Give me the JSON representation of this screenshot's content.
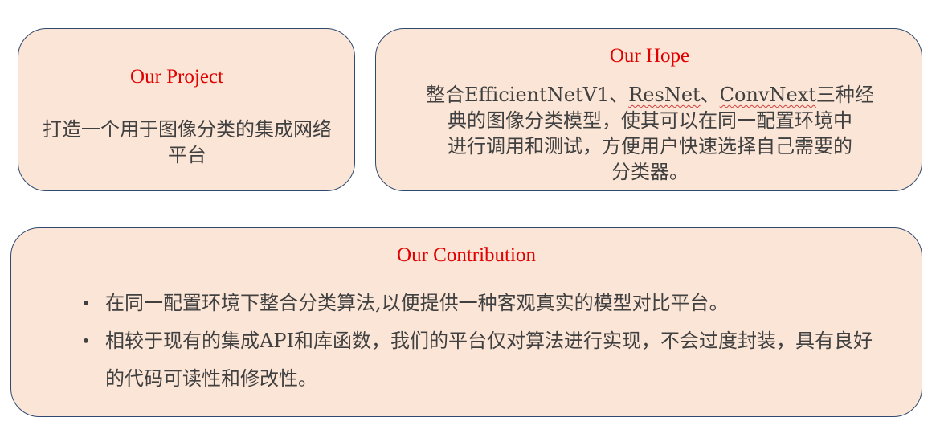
{
  "project": {
    "title": "Our Project",
    "body": "打造一个用于图像分类的集成网络平台"
  },
  "hope": {
    "title": "Our Hope",
    "line1_a": "整合EfficientNetV1、",
    "line1_b": "ResNet",
    "line1_c": "、",
    "line1_d": "ConvNext",
    "line1_e": "三种经",
    "line2": "典的图像分类模型，使其可以在同一配置环境中",
    "line3": "进行调用和测试，方便用户快速选择自己需要的",
    "line4": "分类器。"
  },
  "contribution": {
    "title": "Our Contribution",
    "bullets": [
      "在同一配置环境下整合分类算法,以便提供一种客观真实的模型对比平台。",
      "相较于现有的集成API和库函数，我们的平台仅对算法进行实现，不会过度封装，具有良好的代码可读性和修改性。"
    ],
    "bullet_symbol": "•"
  },
  "colors": {
    "box_fill": "#fbe5d6",
    "box_border": "#2f4a6e",
    "title": "#e00000",
    "text": "#404040"
  }
}
